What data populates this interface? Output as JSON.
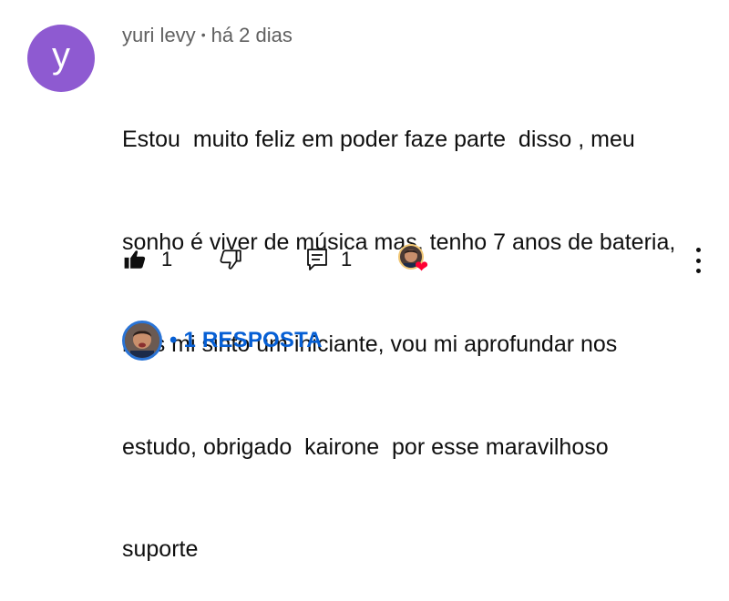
{
  "comment": {
    "avatar_letter": "y",
    "author": "yuri levy",
    "separator": "•",
    "time": "há 2 dias",
    "text_lines": [
      "Estou  muito feliz em poder faze parte  disso , meu",
      "sonho é viver de música mas, tenho 7 anos de bateria,",
      "mas mi sinto um iniciante, vou mi aprofundar nos",
      "estudo, obrigado  kairone  por esse maravilhoso",
      "suporte"
    ]
  },
  "actions": {
    "like_count": "1",
    "reply_count": "1"
  },
  "replies": {
    "label": "• 1 RESPOSTA"
  },
  "icons": {
    "like": "thumbs-up-icon",
    "dislike": "thumbs-down-icon",
    "reply": "reply-comment-icon",
    "heart": "heart-icon",
    "more": "more-vertical-icon"
  },
  "colors": {
    "avatar_bg": "#8e5ad1",
    "link": "#065fd4",
    "heart": "#ff0033",
    "meta_text": "#606060"
  }
}
